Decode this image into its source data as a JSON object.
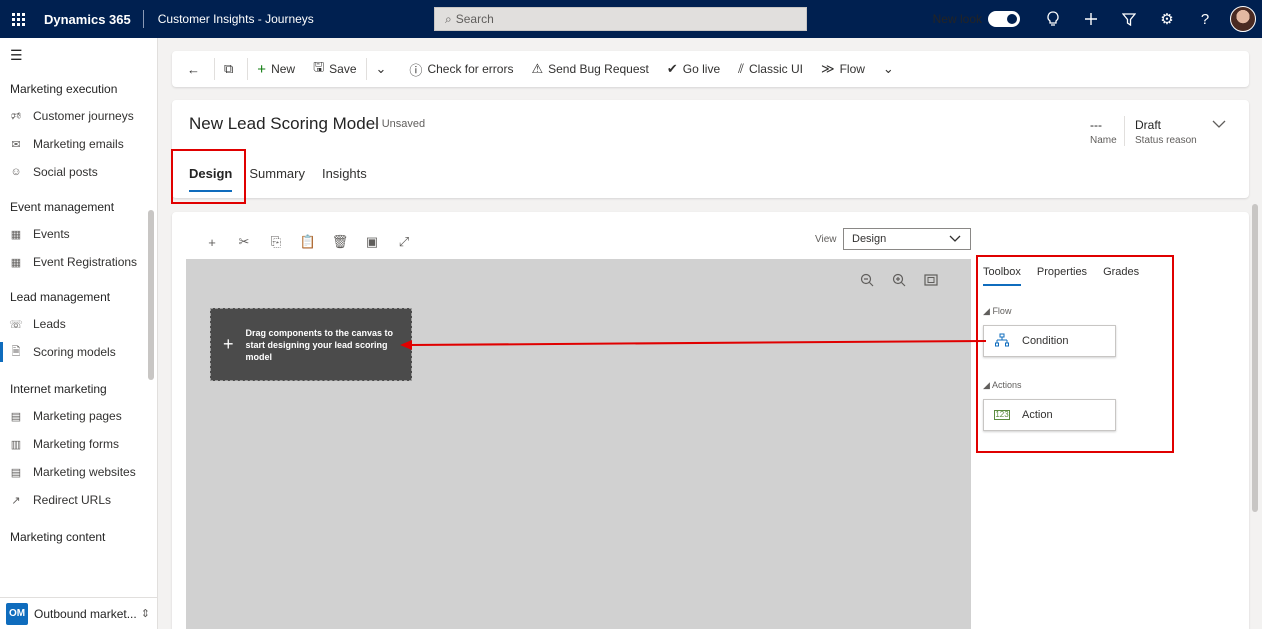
{
  "topbar": {
    "app_name": "Dynamics 365",
    "area_name": "Customer Insights - Journeys",
    "search_placeholder": "Search",
    "new_look_label": "New look"
  },
  "sidebar": {
    "groups": [
      {
        "title": "Marketing execution",
        "items": [
          {
            "label": "Customer journeys",
            "icon": "megaphone-icon"
          },
          {
            "label": "Marketing emails",
            "icon": "mail-icon"
          },
          {
            "label": "Social posts",
            "icon": "social-icon"
          }
        ]
      },
      {
        "title": "Event management",
        "items": [
          {
            "label": "Events",
            "icon": "calendar-icon"
          },
          {
            "label": "Event Registrations",
            "icon": "calendar-icon"
          }
        ]
      },
      {
        "title": "Lead management",
        "items": [
          {
            "label": "Leads",
            "icon": "phone-icon"
          },
          {
            "label": "Scoring models",
            "icon": "scoring-icon"
          }
        ]
      },
      {
        "title": "Internet marketing",
        "items": [
          {
            "label": "Marketing pages",
            "icon": "page-icon"
          },
          {
            "label": "Marketing forms",
            "icon": "form-icon"
          },
          {
            "label": "Marketing websites",
            "icon": "website-icon"
          },
          {
            "label": "Redirect URLs",
            "icon": "redirect-icon"
          }
        ]
      },
      {
        "title": "Marketing content",
        "items": []
      }
    ],
    "area_switcher": {
      "badge": "OM",
      "label": "Outbound market..."
    }
  },
  "command_bar": {
    "new": "New",
    "save": "Save",
    "check_errors": "Check for errors",
    "send_bug": "Send Bug Request",
    "go_live": "Go live",
    "classic_ui": "Classic UI",
    "flow": "Flow"
  },
  "header": {
    "title": "New Lead Scoring Model",
    "unsaved": "- Unsaved",
    "name_value": "---",
    "name_label": "Name",
    "status_value": "Draft",
    "status_label": "Status reason",
    "tabs": [
      "Design",
      "Summary",
      "Insights"
    ]
  },
  "designer": {
    "view_label": "View",
    "view_value": "Design",
    "drop_hint": "Drag components to the canvas to start designing your lead scoring model"
  },
  "toolbox": {
    "tabs": [
      "Toolbox",
      "Properties",
      "Grades"
    ],
    "flow_section": "Flow",
    "condition": "Condition",
    "actions_section": "Actions",
    "action": "Action"
  },
  "colors": {
    "topbar": "#002050",
    "accent": "#0f6cbd",
    "annotation": "#e00000"
  }
}
